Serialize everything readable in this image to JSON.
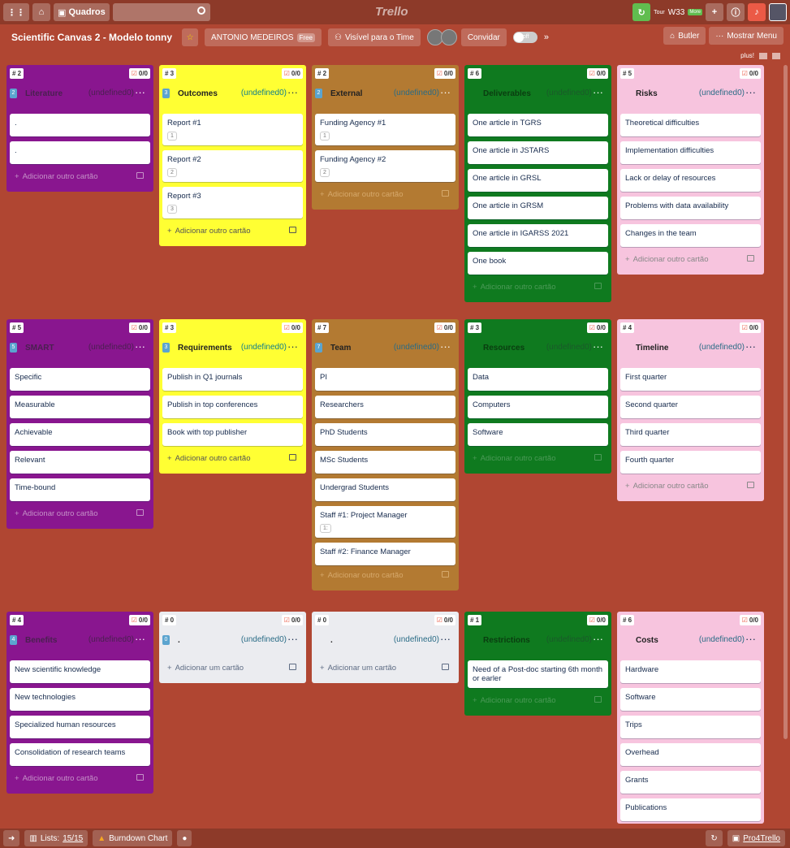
{
  "topnav": {
    "quadros": "Quadros",
    "logo": "Trello",
    "tour": "Tour",
    "w33": "W33",
    "more": "More"
  },
  "board": {
    "title": "Scientific Canvas 2 - Modelo tonny",
    "workspace": "ANTONIO MEDEIROS",
    "free": "Free",
    "visibility": "Visível para o Time",
    "invite": "Convidar",
    "toggle": "off",
    "butler": "Butler",
    "menu": "Mostrar Menu",
    "plus": "plus!"
  },
  "undef": "(undefined0)",
  "add_other": "Adicionar outro cartão",
  "add_one": "Adicionar um cartão",
  "lists": [
    {
      "count": "# 2",
      "checks": "0/0",
      "badge": "2",
      "name": "Literature",
      "cards": [
        {
          "t": "."
        },
        {
          "t": "."
        }
      ]
    },
    {
      "count": "# 3",
      "checks": "0/0",
      "badge": "3",
      "name": "Outcomes",
      "cards": [
        {
          "t": "Report #1",
          "n": "1"
        },
        {
          "t": "Report #2",
          "n": "2"
        },
        {
          "t": "Report #3",
          "n": "3"
        }
      ]
    },
    {
      "count": "# 2",
      "checks": "0/0",
      "badge": "2",
      "name": "External",
      "cards": [
        {
          "t": "Funding Agency #1",
          "n": "1"
        },
        {
          "t": "Funding Agency #2",
          "n": "2"
        }
      ]
    },
    {
      "count": "# 6",
      "checks": "0/0",
      "badge": "",
      "name": "Deliverables",
      "cards": [
        {
          "t": "One article in TGRS"
        },
        {
          "t": "One article in JSTARS"
        },
        {
          "t": "One article in GRSL"
        },
        {
          "t": "One article in GRSM"
        },
        {
          "t": "One article in IGARSS 2021"
        },
        {
          "t": "One book"
        }
      ]
    },
    {
      "count": "# 5",
      "checks": "0/0",
      "badge": "",
      "name": "Risks",
      "cards": [
        {
          "t": "Theoretical difficulties"
        },
        {
          "t": "Implementation difficulties"
        },
        {
          "t": "Lack or delay of resources"
        },
        {
          "t": "Problems with data availability"
        },
        {
          "t": "Changes in the team"
        }
      ]
    },
    {
      "count": "# 5",
      "checks": "0/0",
      "badge": "5",
      "name": "SMART",
      "cards": [
        {
          "t": "Specific"
        },
        {
          "t": "Measurable"
        },
        {
          "t": "Achievable"
        },
        {
          "t": "Relevant"
        },
        {
          "t": "Time-bound"
        }
      ]
    },
    {
      "count": "# 3",
      "checks": "0/0",
      "badge": "3",
      "name": "Requirements",
      "cards": [
        {
          "t": "Publish in Q1 journals"
        },
        {
          "t": "Publish in top conferences"
        },
        {
          "t": "Book with top publisher"
        }
      ]
    },
    {
      "count": "# 7",
      "checks": "0/0",
      "badge": "7",
      "name": "Team",
      "cards": [
        {
          "t": "PI"
        },
        {
          "t": "Researchers"
        },
        {
          "t": "PhD Students"
        },
        {
          "t": "MSc Students"
        },
        {
          "t": "Undergrad Students"
        },
        {
          "t": "Staff #1: Project Manager",
          "n": "1:"
        },
        {
          "t": "Staff #2: Finance Manager"
        }
      ]
    },
    {
      "count": "# 3",
      "checks": "0/0",
      "badge": "",
      "name": "Resources",
      "cards": [
        {
          "t": "Data"
        },
        {
          "t": "Computers"
        },
        {
          "t": "Software"
        }
      ]
    },
    {
      "count": "# 4",
      "checks": "0/0",
      "badge": "",
      "name": "Timeline",
      "cards": [
        {
          "t": "First quarter"
        },
        {
          "t": "Second quarter"
        },
        {
          "t": "Third quarter"
        },
        {
          "t": "Fourth quarter"
        }
      ]
    },
    {
      "count": "# 4",
      "checks": "0/0",
      "badge": "4",
      "name": "Benefits",
      "cards": [
        {
          "t": "New scientific knowledge"
        },
        {
          "t": "New technologies"
        },
        {
          "t": "Specialized human resources"
        },
        {
          "t": "Consolidation of research teams"
        }
      ]
    },
    {
      "count": "# 0",
      "checks": "0/0",
      "badge": "0",
      "name": ".",
      "cards": []
    },
    {
      "count": "# 0",
      "checks": "0/0",
      "badge": "",
      "name": ".",
      "cards": []
    },
    {
      "count": "# 1",
      "checks": "0/0",
      "badge": "",
      "name": "Restrictions",
      "cards": [
        {
          "t": "Need of a Post-doc starting 6th month or earler"
        }
      ]
    },
    {
      "count": "# 6",
      "checks": "0/0",
      "badge": "",
      "name": "Costs",
      "cards": [
        {
          "t": "Hardware"
        },
        {
          "t": "Software"
        },
        {
          "t": "Trips"
        },
        {
          "t": "Overhead"
        },
        {
          "t": "Grants"
        },
        {
          "t": "Publications"
        }
      ]
    }
  ],
  "bottom": {
    "lists_label": "Lists:",
    "lists_value": "15/15",
    "burndown": "Burndown Chart",
    "pro4trello": "Pro4Trello"
  },
  "colors": {
    "background": "#b04632",
    "purple": "#89168f",
    "yellow": "#ffff33",
    "brown": "#b37a32",
    "green": "#0f7a1f",
    "pink": "#f7c4de",
    "grey": "#ebecf0"
  }
}
